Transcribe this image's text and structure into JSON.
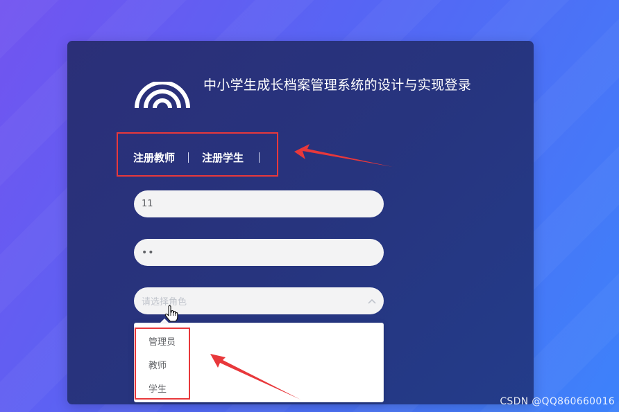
{
  "header": {
    "title": "中小学生成长档案管理系统的设计与实现登录"
  },
  "tabs": [
    {
      "label": "注册教师"
    },
    {
      "label": "注册学生"
    }
  ],
  "form": {
    "username_value": "11",
    "password_value": "••",
    "role_placeholder": "请选择角色"
  },
  "role_options": [
    "管理员",
    "教师",
    "学生"
  ],
  "icons": {
    "logo": "wifi-arcs-logo",
    "chevron": "chevron-up-icon",
    "cursor": "hand-pointer-icon"
  },
  "colors": {
    "panel_bg": "#2a3480",
    "highlight": "#e8383b",
    "field_bg": "#f3f3f4"
  },
  "watermark": "CSDN @QQ860660016"
}
